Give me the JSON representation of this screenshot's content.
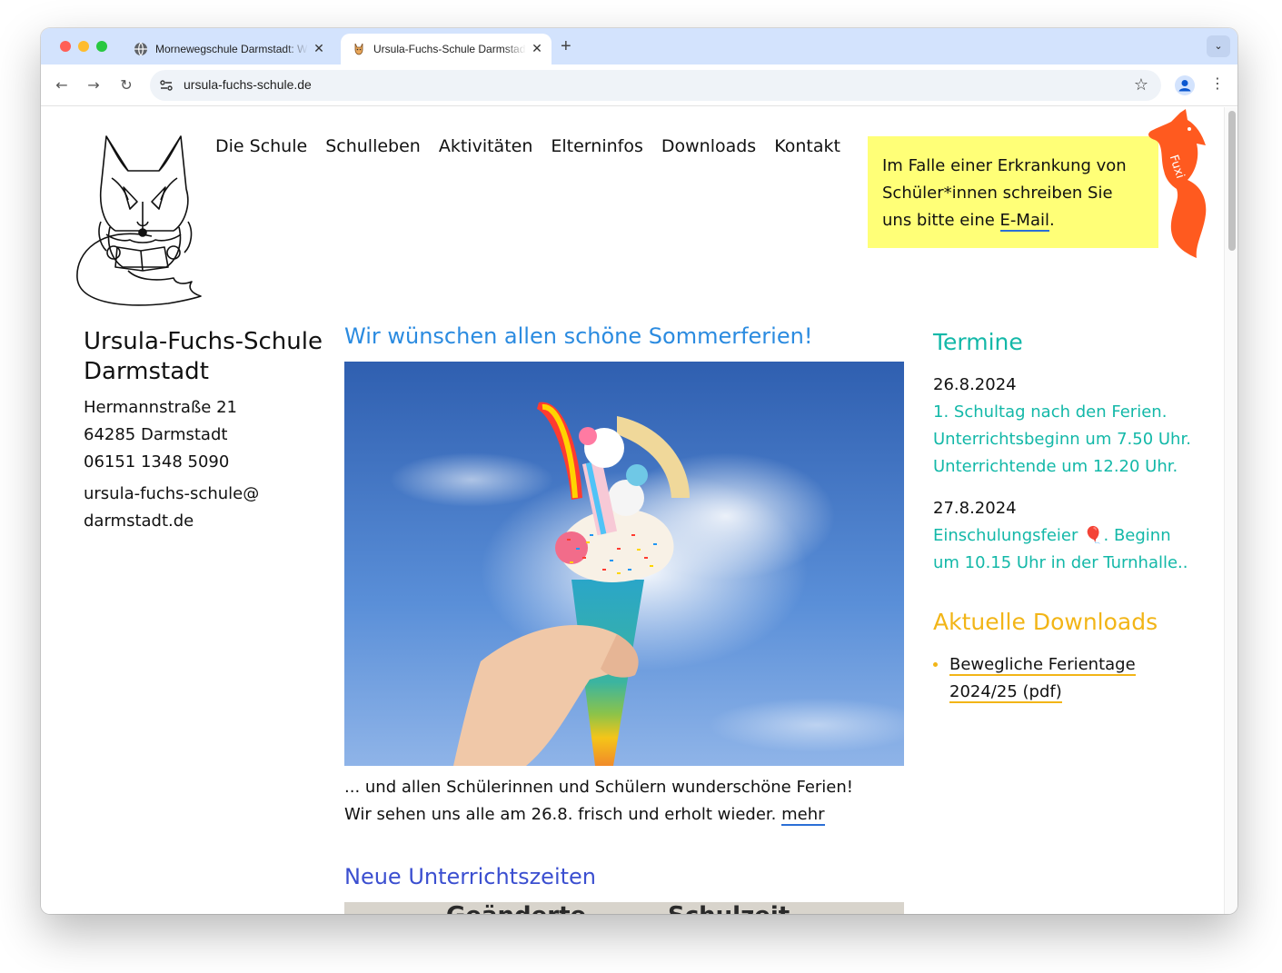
{
  "browser": {
    "tabs": [
      {
        "title": "Mornewegschule Darmstadt: Willkommen",
        "active": false
      },
      {
        "title": "Ursula-Fuchs-Schule Darmstadt",
        "active": true
      }
    ],
    "close_glyph": "✕",
    "new_tab_glyph": "+",
    "tab_menu_glyph": "⌄",
    "url": "ursula-fuchs-schule.de",
    "back_glyph": "←",
    "forward_glyph": "→",
    "reload_glyph": "↻",
    "star_glyph": "☆",
    "menu_glyph": "⋮"
  },
  "nav": {
    "items": [
      "Die Schule",
      "Schulleben",
      "Aktivitäten",
      "Elterninfos",
      "Downloads",
      "Kontakt"
    ]
  },
  "notice": {
    "text_before": "Im Falle einer Erkrankung von Schüler*innen schreiben Sie uns bitte eine ",
    "link": "E-Mail",
    "text_after": ".",
    "mascot_label": "Fuxi"
  },
  "school": {
    "name_line1": "Ursula-Fuchs-Schule",
    "name_line2": "Darmstadt",
    "street": "Hermannstraße 21",
    "city": "64285 Darmstadt",
    "phone": "06151 1348 5090",
    "email_line1": "ursula-fuchs-schule@",
    "email_line2": "darmstadt.de"
  },
  "posts": [
    {
      "title": "Wir wünschen allen schöne Sommerferien!",
      "line1": "... und allen Schülerinnen und Schülern wunderschöne Ferien!",
      "line2": "Wir sehen uns alle am 26.8. frisch und erholt wieder. ",
      "more": "mehr"
    },
    {
      "title": "Neue Unterrichtszeiten",
      "image_text_1": "Geänderte",
      "image_text_2": "Schulzeit"
    }
  ],
  "sidebar": {
    "termine_heading": "Termine",
    "events": [
      {
        "date": "26.8.2024",
        "lines": [
          "1. Schultag nach den Ferien.",
          "Unterrichtsbeginn um 7.50 Uhr.",
          "Unterrichtende um 12.20 Uhr."
        ]
      },
      {
        "date": "27.8.2024",
        "lines": [
          "Einschulungsfeier 🎈. Beginn",
          "um 10.15 Uhr in der Turnhalle.."
        ]
      }
    ],
    "downloads_heading": "Aktuelle Downloads",
    "downloads": [
      {
        "line1": "Bewegliche Ferientage",
        "line2": "2024/25 (pdf)"
      }
    ]
  },
  "colors": {
    "teal": "#13b8a8",
    "gold": "#f2b517",
    "link_blue": "#2b8be0",
    "notice_yellow": "#ffff77",
    "fox_orange": "#ff5a1f"
  }
}
